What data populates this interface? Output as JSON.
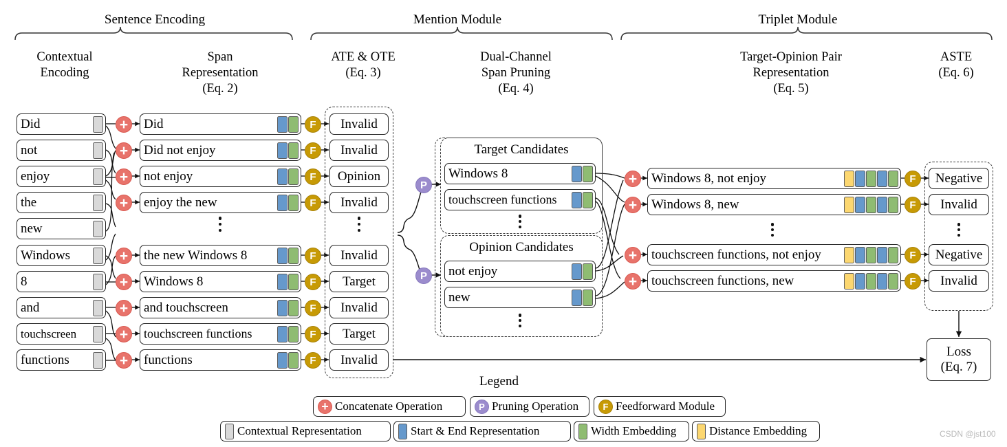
{
  "figure": {
    "watermark": "CSDN @jst100",
    "colors": {
      "concat": "#e8736b",
      "prune": "#9b8ccd",
      "feedforward": "#c79a05",
      "contextual": "#d9d9d9",
      "start_end": "#6699cc",
      "width": "#8fbc72",
      "distance": "#fcd770"
    }
  },
  "groups": [
    {
      "label": "Sentence Encoding"
    },
    {
      "label": "Mention Module"
    },
    {
      "label": "Triplet Module"
    }
  ],
  "columns": [
    {
      "label": "Contextual\nEncoding",
      "title": "Contextual",
      "sub": "Encoding",
      "eq": ""
    },
    {
      "label": "Span Representation",
      "title": "Span",
      "sub": "Representation",
      "eq": "(Eq. 2)"
    },
    {
      "label": "ATE & OTE",
      "title": "ATE & OTE",
      "sub": "",
      "eq": "(Eq. 3)"
    },
    {
      "label": "Dual-Channel Span Pruning",
      "title": "Dual-Channel",
      "sub": "Span Pruning",
      "eq": "(Eq. 4)"
    },
    {
      "label": "Target-Opinion Pair Representation",
      "title": "Target-Opinion Pair",
      "sub": "Representation",
      "eq": "(Eq. 5)"
    },
    {
      "label": "ASTE",
      "title": "ASTE",
      "sub": "",
      "eq": "(Eq. 6)"
    }
  ],
  "tokens": [
    {
      "text": "Did"
    },
    {
      "text": "not"
    },
    {
      "text": "enjoy"
    },
    {
      "text": "the"
    },
    {
      "text": "new"
    },
    {
      "text": "Windows"
    },
    {
      "text": "8"
    },
    {
      "text": "and"
    },
    {
      "text": "touchscreen"
    },
    {
      "text": "functions"
    }
  ],
  "spans": [
    {
      "text": "Did"
    },
    {
      "text": "Did not enjoy"
    },
    {
      "text": "not enjoy"
    },
    {
      "text": "enjoy the new"
    },
    {
      "text": "the new Windows 8"
    },
    {
      "text": "Windows 8"
    },
    {
      "text": "and touchscreen"
    },
    {
      "text": "touchscreen functions"
    },
    {
      "text": "functions"
    }
  ],
  "ate_ote_labels": [
    {
      "text": "Invalid"
    },
    {
      "text": "Invalid"
    },
    {
      "text": "Opinion"
    },
    {
      "text": "Invalid"
    },
    {
      "text": "Invalid"
    },
    {
      "text": "Target"
    },
    {
      "text": "Invalid"
    },
    {
      "text": "Target"
    },
    {
      "text": "Invalid"
    }
  ],
  "pruning": {
    "target_group_label": "Target Candidates",
    "opinion_group_label": "Opinion Candidates",
    "target_candidates": [
      {
        "text": "Windows 8"
      },
      {
        "text": "touchscreen functions"
      }
    ],
    "opinion_candidates": [
      {
        "text": "not enjoy"
      },
      {
        "text": "new"
      }
    ]
  },
  "pairs": [
    {
      "text": "Windows 8, not enjoy"
    },
    {
      "text": "Windows 8, new"
    },
    {
      "text": "touchscreen functions, not enjoy"
    },
    {
      "text": "touchscreen functions, new"
    }
  ],
  "aste_labels": [
    {
      "text": "Negative"
    },
    {
      "text": "Invalid"
    },
    {
      "text": "Negative"
    },
    {
      "text": "Invalid"
    }
  ],
  "loss": {
    "line1": "Loss",
    "line2": "(Eq. 7)"
  },
  "legend": {
    "title": "Legend",
    "operations": [
      {
        "icon": "concatenate-icon",
        "glyph": "+",
        "label": "Concatenate Operation"
      },
      {
        "icon": "pruning-icon",
        "glyph": "P",
        "label": "Pruning Operation"
      },
      {
        "icon": "feedforward-icon",
        "glyph": "F",
        "label": "Feedforward Module"
      }
    ],
    "representations": [
      {
        "swatch": "contextual",
        "label": "Contextual Representation"
      },
      {
        "swatch": "start_end",
        "label": "Start & End Representation"
      },
      {
        "swatch": "width",
        "label": "Width Embedding"
      },
      {
        "swatch": "distance",
        "label": "Distance Embedding"
      }
    ]
  }
}
